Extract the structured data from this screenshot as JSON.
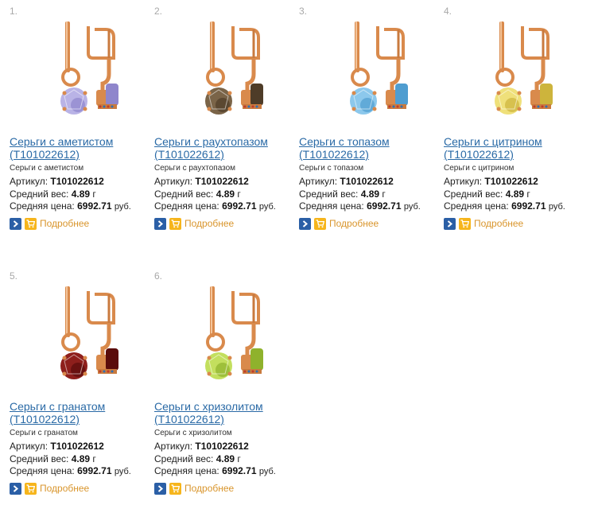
{
  "products": [
    {
      "num": "1.",
      "title": "Серьги с аметистом (Т101022612)",
      "subtitle": "Серьги с аметистом",
      "article_label": "Артикул:",
      "article": "Т101022612",
      "weight_label": "Средний вес:",
      "weight": "4.89",
      "weight_unit": "г",
      "price_label": "Средняя цена:",
      "price": "6992.71",
      "currency": "руб.",
      "more_label": "Подробнее",
      "stone_color": "#b9b3e6",
      "stone_dark": "#8f86cc"
    },
    {
      "num": "2.",
      "title": "Серьги с раухтопазом (Т101022612)",
      "subtitle": "Серьги с раухтопазом",
      "article_label": "Артикул:",
      "article": "Т101022612",
      "weight_label": "Средний вес:",
      "weight": "4.89",
      "weight_unit": "г",
      "price_label": "Средняя цена:",
      "price": "6992.71",
      "currency": "руб.",
      "more_label": "Подробнее",
      "stone_color": "#7a6448",
      "stone_dark": "#4e3c28"
    },
    {
      "num": "3.",
      "title": "Серьги с топазом (Т101022612)",
      "subtitle": "Серьги с топазом",
      "article_label": "Артикул:",
      "article": "Т101022612",
      "weight_label": "Средний вес:",
      "weight": "4.89",
      "weight_unit": "г",
      "price_label": "Средняя цена:",
      "price": "6992.71",
      "currency": "руб.",
      "more_label": "Подробнее",
      "stone_color": "#8cc8ec",
      "stone_dark": "#4f9dd0"
    },
    {
      "num": "4.",
      "title": "Серьги с цитрином (Т101022612)",
      "subtitle": "Серьги с цитрином",
      "article_label": "Артикул:",
      "article": "Т101022612",
      "weight_label": "Средний вес:",
      "weight": "4.89",
      "weight_unit": "г",
      "price_label": "Средняя цена:",
      "price": "6992.71",
      "currency": "руб.",
      "more_label": "Подробнее",
      "stone_color": "#efe07a",
      "stone_dark": "#cdb43c"
    },
    {
      "num": "5.",
      "title": "Серьги с гранатом (Т101022612)",
      "subtitle": "Серьги с гранатом",
      "article_label": "Артикул:",
      "article": "Т101022612",
      "weight_label": "Средний вес:",
      "weight": "4.89",
      "weight_unit": "г",
      "price_label": "Средняя цена:",
      "price": "6992.71",
      "currency": "руб.",
      "more_label": "Подробнее",
      "stone_color": "#8e1f1c",
      "stone_dark": "#5a0c0b"
    },
    {
      "num": "6.",
      "title": "Серьги с хризолитом (Т101022612)",
      "subtitle": "Серьги с хризолитом",
      "article_label": "Артикул:",
      "article": "Т101022612",
      "weight_label": "Средний вес:",
      "weight": "4.89",
      "weight_unit": "г",
      "price_label": "Средняя цена:",
      "price": "6992.71",
      "currency": "руб.",
      "more_label": "Подробнее",
      "stone_color": "#c3df5e",
      "stone_dark": "#8fb22c"
    }
  ],
  "icons": {
    "arrow": "chevron-right-icon",
    "cart": "cart-icon"
  },
  "colors": {
    "link": "#2a6aa6",
    "more": "#d9952c",
    "arrow_button": "#2b5fa6",
    "cart_button": "#f6b51c",
    "gold": "#d98a4c"
  }
}
